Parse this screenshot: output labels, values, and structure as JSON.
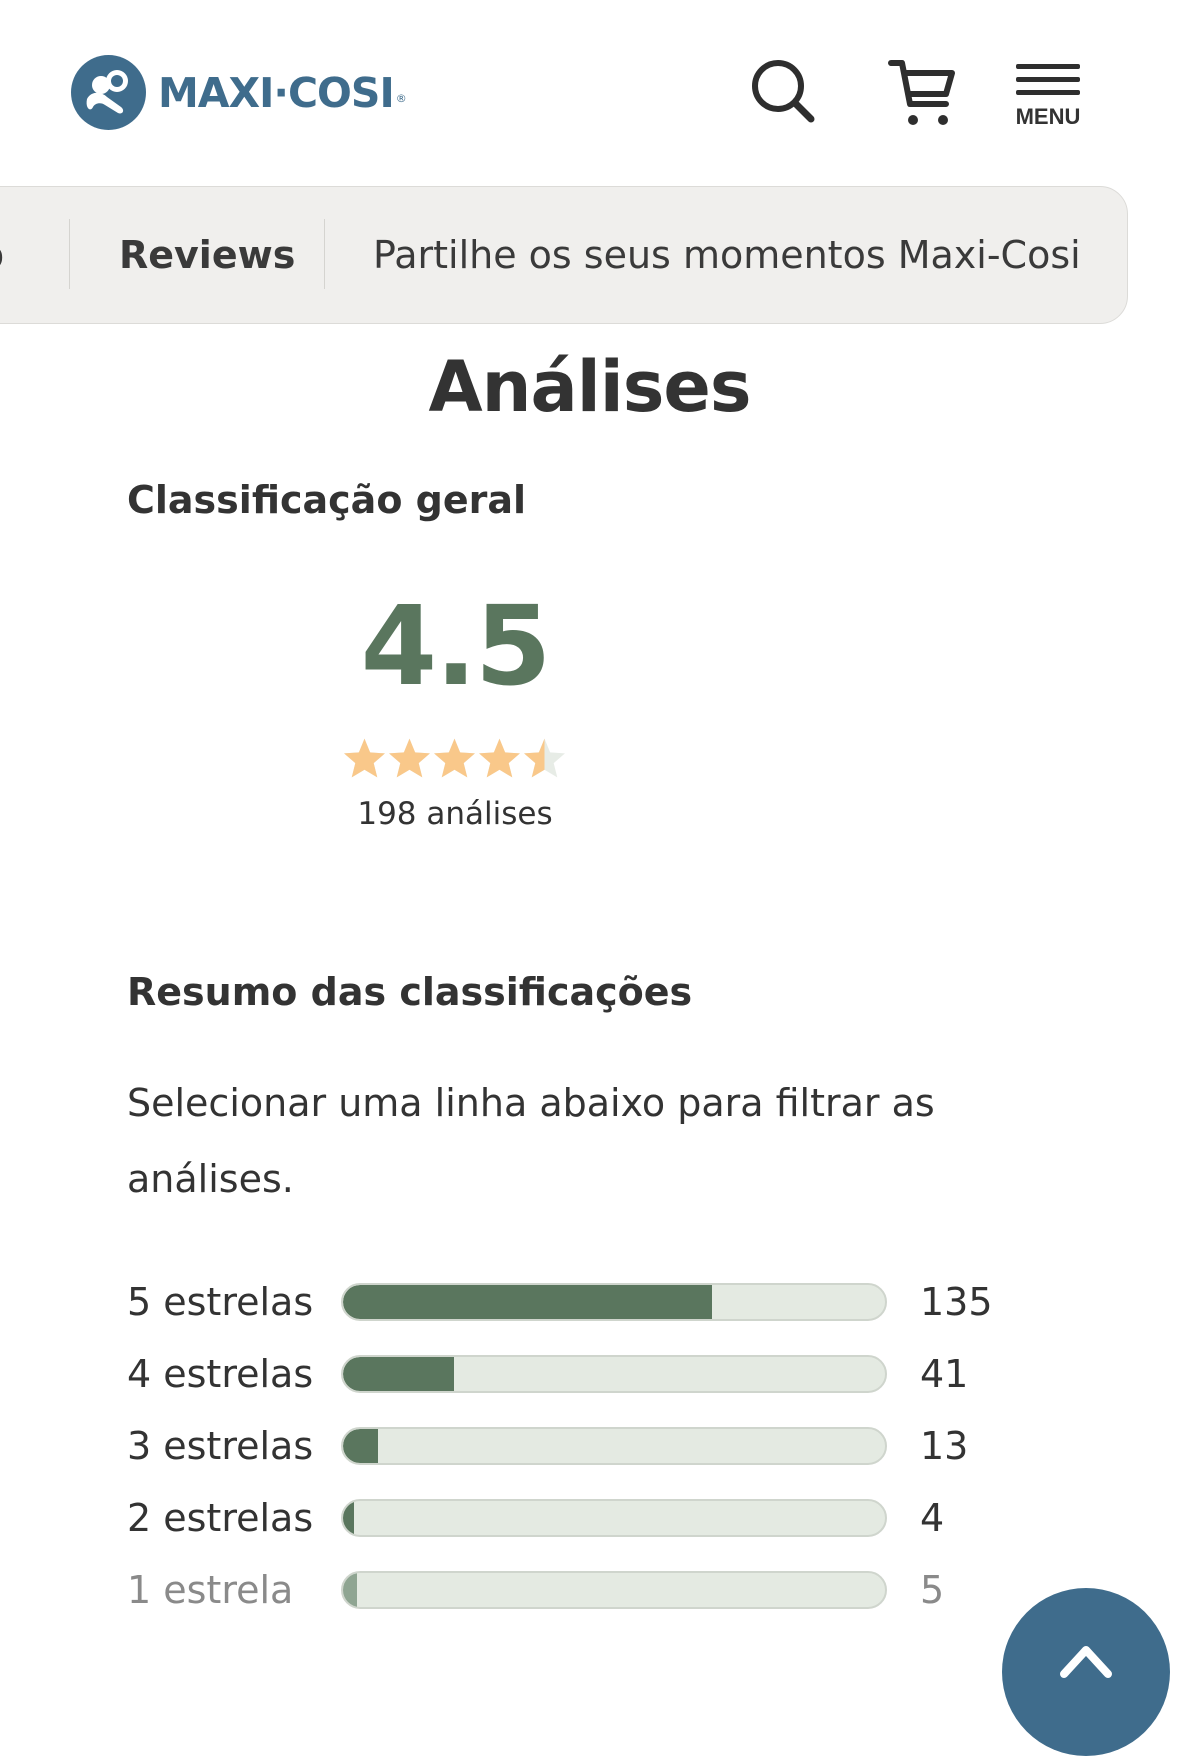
{
  "brand": {
    "name": "MAXI·COSI",
    "reg_mark": "®",
    "color": "#3f6c8c"
  },
  "header": {
    "icons": [
      "search-icon",
      "cart-icon",
      "menu-icon"
    ],
    "menu_label": "MENU"
  },
  "tabs": {
    "partial_label": "o",
    "items": [
      {
        "label": "Reviews",
        "active": true
      },
      {
        "label": "Partilhe os seus momentos Maxi-Cosi",
        "active": false
      }
    ]
  },
  "page": {
    "title": "Análises"
  },
  "overall": {
    "heading": "Classificação geral",
    "score": "4.5",
    "rating": 4.5,
    "max_rating": 5,
    "review_count": "198 análises",
    "star_color": "#f9c88a",
    "score_color": "#5a765e"
  },
  "summary": {
    "heading": "Resumo das classificações",
    "instructions": "Selecionar uma linha abaixo para filtrar as análises.",
    "rows": [
      {
        "label": "5 estrelas",
        "count": "135",
        "fraction": 0.68
      },
      {
        "label": "4 estrelas",
        "count": "41",
        "fraction": 0.205
      },
      {
        "label": "3 estrelas",
        "count": "13",
        "fraction": 0.065
      },
      {
        "label": "2 estrelas",
        "count": "4",
        "fraction": 0.02
      },
      {
        "label": "1 estrela",
        "count": "5",
        "fraction": 0.025
      }
    ],
    "bar_fill_color": "#5a765e",
    "bar_track_color": "#e4eae2"
  },
  "floating": {
    "icon": "chevron-up-icon"
  }
}
